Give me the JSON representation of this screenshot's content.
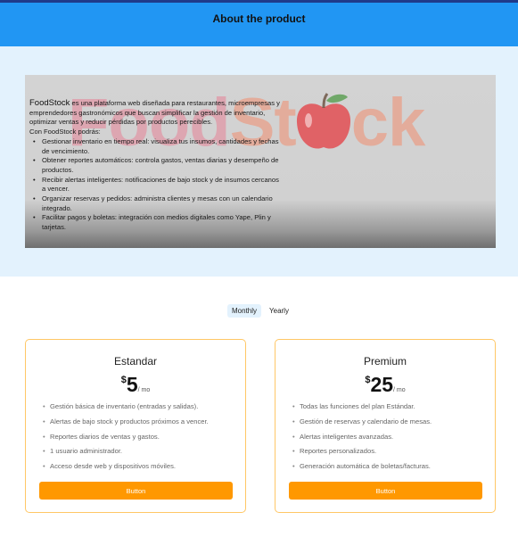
{
  "header": {
    "title": "About the product"
  },
  "about": {
    "logo": {
      "part1": "Food",
      "part2": "St",
      "part3": "ck"
    },
    "brand": "FoodStock",
    "intro": " es una plataforma web diseñada para restaurantes, microempresas y emprendedores gastronómicos que buscan simplificar la gestión de inventario, optimizar ventas y reducir pérdidas por productos perecibles.",
    "lead": "Con FoodStock podrás:",
    "features": [
      "Gestionar inventario en tiempo real: visualiza tus insumos, cantidades y fechas de vencimiento.",
      "Obtener reportes automáticos: controla gastos, ventas diarias y desempeño de productos.",
      "Recibir alertas inteligentes: notificaciones de bajo stock y de insumos cercanos a vencer.",
      "Organizar reservas y pedidos: administra clientes y mesas con un calendario integrado.",
      "Facilitar pagos y boletas: integración con medios digitales como Yape, Plin y tarjetas."
    ]
  },
  "billing_toggle": {
    "monthly": "Monthly",
    "yearly": "Yearly",
    "active": "monthly"
  },
  "plans": [
    {
      "name": "Estandar",
      "currency": "$",
      "amount": "5",
      "period": "/ mo",
      "features": [
        "Gestión básica de inventario (entradas y salidas).",
        "Alertas de bajo stock y productos próximos a vencer.",
        "Reportes diarios de ventas y gastos.",
        "1 usuario administrador.",
        "Acceso desde web y dispositivos móviles."
      ],
      "button": "Button"
    },
    {
      "name": "Premium",
      "currency": "$",
      "amount": "25",
      "period": "/ mo",
      "features": [
        "Todas las funciones del plan Estándar.",
        "Gestión de reservas y calendario de mesas.",
        "Alertas inteligentes avanzadas.",
        "Reportes personalizados.",
        "Generación automática de boletas/facturas."
      ],
      "button": "Button"
    }
  ],
  "colors": {
    "header_bg": "#2196f3",
    "section_bg": "#e3f2fd",
    "accent": "#ff9800",
    "card_border": "#ffc766"
  },
  "icons": {
    "logo_apple": "apple-icon"
  }
}
